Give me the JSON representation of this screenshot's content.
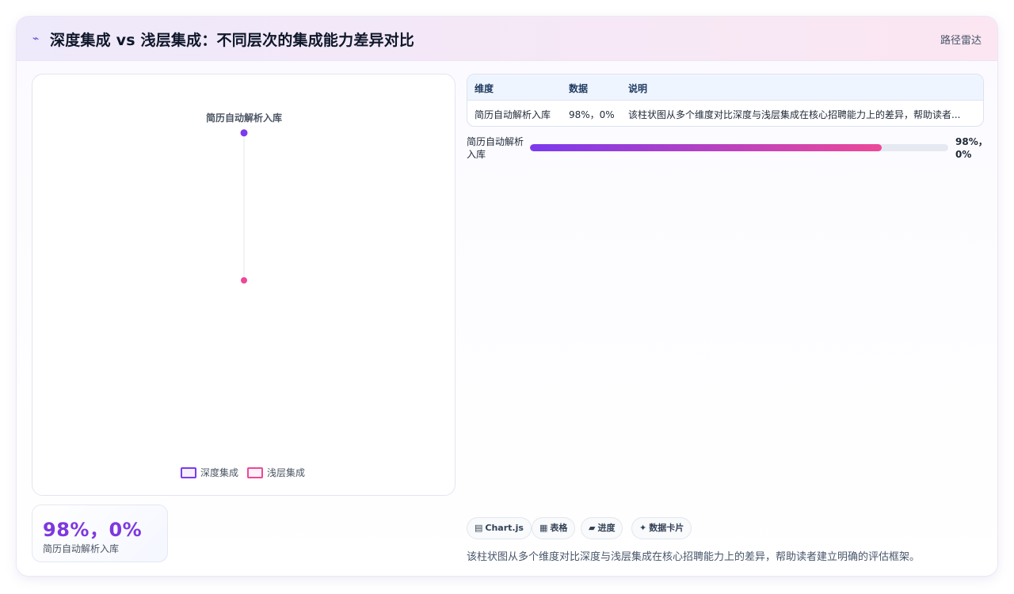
{
  "header": {
    "icon": "pulse-icon",
    "title": "深度集成 vs 浅层集成：不同层次的集成能力差异对比",
    "tag": "路径雷达"
  },
  "colors": {
    "deep": "#7c3aed",
    "shallow": "#ec4899",
    "accent": "#7e38de"
  },
  "chart_data": {
    "type": "radar",
    "axes": [
      "简历自动解析入库"
    ],
    "series": [
      {
        "name": "深度集成",
        "values": [
          98
        ]
      },
      {
        "name": "浅层集成",
        "values": [
          0
        ]
      }
    ],
    "rlim": [
      0,
      100
    ],
    "legend_position": "bottom"
  },
  "stat": {
    "value": "98%，0%",
    "label": "简历自动解析入库"
  },
  "table": {
    "headers": [
      "维度",
      "数据",
      "说明"
    ],
    "rows": [
      {
        "dimension": "简历自动解析入库",
        "data": "98%，0%",
        "desc": "该柱状图从多个维度对比深度与浅层集成在核心招聘能力上的差异，帮助读者..."
      }
    ]
  },
  "progress": [
    {
      "label": "简历自动解析入库",
      "value_text": "98%，0%",
      "fraction": 0.84
    }
  ],
  "chips": [
    {
      "icon": "chart-icon",
      "glyph": "▤",
      "label": "Chart.js"
    },
    {
      "icon": "table-icon",
      "glyph": "▦",
      "label": "表格"
    },
    {
      "icon": "progress-icon",
      "glyph": "▰",
      "label": "进度"
    },
    {
      "icon": "sparkle-icon",
      "glyph": "✦",
      "label": "数据卡片"
    }
  ],
  "footer": "该柱状图从多个维度对比深度与浅层集成在核心招聘能力上的差异，帮助读者建立明确的评估框架。"
}
